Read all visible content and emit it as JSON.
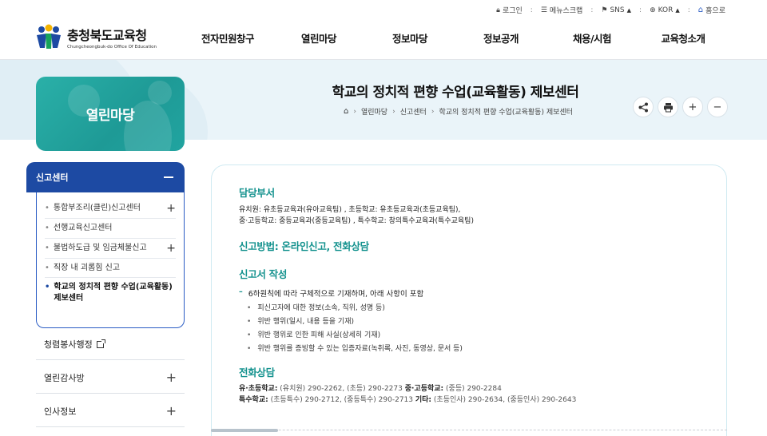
{
  "utility": {
    "login": "로그인",
    "sitemap": "메뉴스크랩",
    "sns": "SNS",
    "lang": "KOR",
    "home": "홈으로"
  },
  "logo": {
    "name_kr": "충청북도교육청",
    "name_en": "Chungcheongbuk-do Office Of Education"
  },
  "gnb": [
    "전자민원창구",
    "열린마당",
    "정보마당",
    "정보공개",
    "채용/시험",
    "교육청소개"
  ],
  "section_title": "열린마당",
  "page_title": "학교의 정치적 편향 수업(교육활동) 제보센터",
  "breadcrumb": [
    "열린마당",
    "신고센터",
    "학교의 정치적 편향 수업(교육활동) 제보센터"
  ],
  "tools": [
    "share-icon",
    "print-icon",
    "zoom-in-icon",
    "zoom-out-icon"
  ],
  "lnb": {
    "current": "신고센터",
    "subs": [
      {
        "label": "통합부조리(클린)신고센터",
        "has_children": true
      },
      {
        "label": "선행교육신고센터",
        "has_children": false
      },
      {
        "label": "불법하도급 및 임금체불신고",
        "has_children": true
      },
      {
        "label": "직장 내 괴롭힘 신고",
        "has_children": false
      },
      {
        "label_line1": "학교의 정치적 편향 수업(교육활동)",
        "label_line2": "제보센터",
        "active": true
      }
    ],
    "mains": [
      {
        "label": "청렴봉사행정",
        "external": true
      },
      {
        "label": "열린감사방",
        "has_children": true
      },
      {
        "label": "인사정보",
        "has_children": true
      }
    ]
  },
  "content": {
    "dept_heading": "담당부서",
    "dept_line1_a": "유치원: 유초등교육과(유아교육팀) , 초등학교: 유초등교육과(초등교육팀),",
    "dept_line2_a": "중·고등학교: 중등교육과(중등교육팀) , 특수학교: 창의특수교육과(특수교육팀)",
    "method_heading": "신고방법: 온라인신고, 전화상담",
    "report_heading": "신고서 작성",
    "report_intro": "6하원칙에 따라 구체적으로 기재하며, 아래 사항이 포함",
    "report_items": [
      "피신고자에 대한 정보(소속, 직위, 성명 등)",
      "위반 행위(일시, 내용 등을 기재)",
      "위반 행위로 인한 피해 사실(상세히 기재)",
      "위반 행위를 증빙할 수 있는 입증자료(녹취록, 사진, 동영상, 문서 등)"
    ],
    "phone_heading": "전화상담",
    "phone_row1": {
      "k1": "유·초등학교:",
      "v1": "(유치원) 290-2262, (초등) 290-2273",
      "k2": "중·고등학교:",
      "v2": "(중등) 290-2284"
    },
    "phone_row2": {
      "k1": "특수학교:",
      "v1": "(초등특수) 290-2712, (중등특수) 290-2713",
      "k2": "기타:",
      "v2": "(초등인사) 290-2634, (중등인사) 290-2643"
    }
  },
  "colors": {
    "primary_blue": "#1d4aa3",
    "teal": "#14928e",
    "band_bg": "#eaf4f9"
  }
}
